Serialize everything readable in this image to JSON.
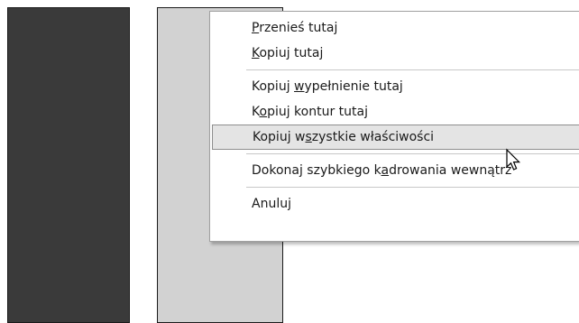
{
  "menu": {
    "items": [
      {
        "pre": "",
        "key": "P",
        "post": "rzenieś tutaj"
      },
      {
        "pre": "",
        "key": "K",
        "post": "opiuj tutaj"
      },
      {
        "pre": "Kopiuj ",
        "key": "w",
        "post": "ypełnienie tutaj"
      },
      {
        "pre": "K",
        "key": "o",
        "post": "piuj kontur tutaj"
      },
      {
        "pre": "Kopiuj w",
        "key": "s",
        "post": "zystkie właściwości"
      },
      {
        "pre": "Dokonaj szybkiego k",
        "key": "a",
        "post": "drowania wewnątrz"
      },
      {
        "pre": "Anuluj",
        "key": "",
        "post": ""
      }
    ]
  },
  "icons": {
    "cursor": "arrow-cursor-icon"
  },
  "colors": {
    "dark_panel": "#3a3a3a",
    "light_panel": "#d2d2d2",
    "highlight": "#e4e4e4"
  }
}
